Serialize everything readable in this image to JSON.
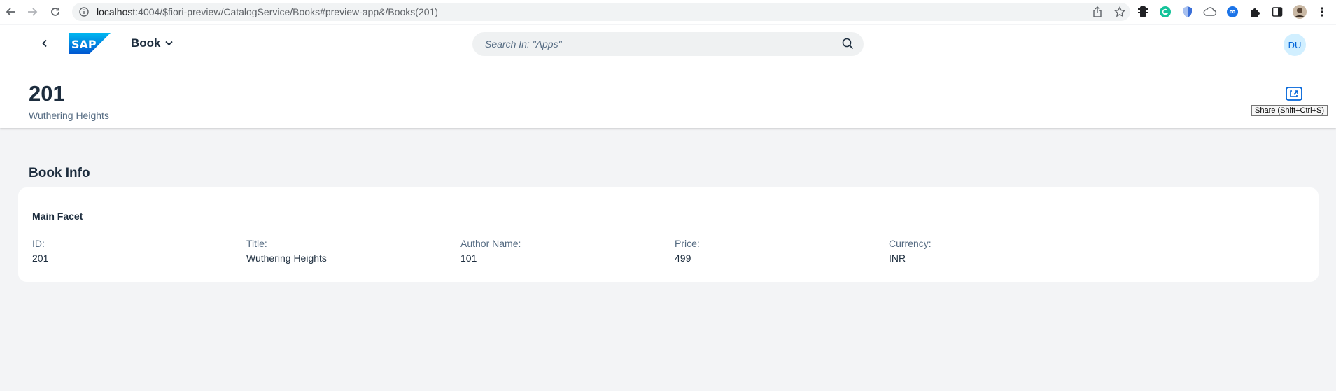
{
  "browser": {
    "url_host": "localhost",
    "url_rest": ":4004/$fiori-preview/CatalogService/Books#preview-app&/Books(201)"
  },
  "shell": {
    "logo_text": "SAP",
    "app_title": "Book",
    "search_placeholder": "Search In: \"Apps\"",
    "avatar_initials": "DU"
  },
  "header": {
    "title": "201",
    "subtitle": "Wuthering Heights",
    "share_tooltip": "Share (Shift+Ctrl+S)"
  },
  "section": {
    "title": "Book Info",
    "facet_title": "Main Facet",
    "fields": [
      {
        "label": "ID:",
        "value": "201"
      },
      {
        "label": "Title:",
        "value": "Wuthering Heights"
      },
      {
        "label": "Author Name:",
        "value": "101"
      },
      {
        "label": "Price:",
        "value": "499"
      },
      {
        "label": "Currency:",
        "value": "INR"
      }
    ]
  },
  "colors": {
    "brand_blue": "#0a6ed1",
    "accent": "#0064d9",
    "text": "#1d2d3e",
    "background": "#f3f4f6"
  }
}
